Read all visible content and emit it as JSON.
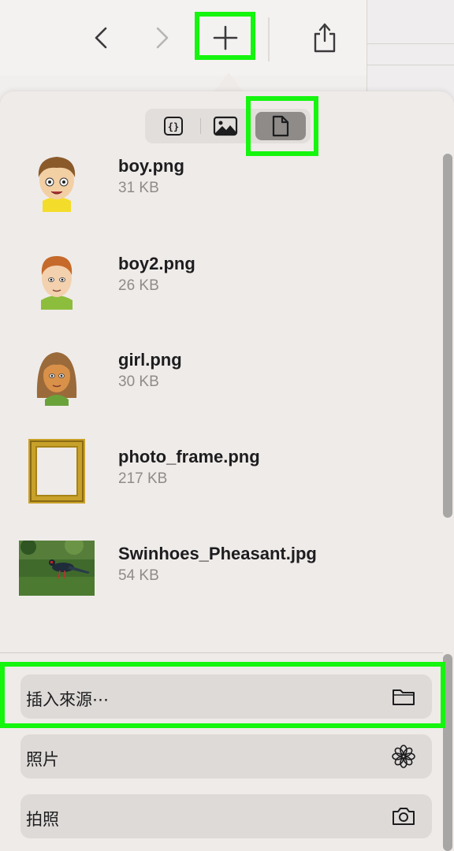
{
  "toolbar": {
    "buttons": [
      {
        "name": "back",
        "icon": "chevron-left-icon"
      },
      {
        "name": "forward",
        "icon": "chevron-right-icon"
      },
      {
        "name": "add",
        "icon": "plus-icon"
      },
      {
        "name": "share",
        "icon": "share-icon"
      }
    ]
  },
  "segmented": {
    "items": [
      {
        "icon": "code-braces-icon",
        "selected": false
      },
      {
        "icon": "photo-icon",
        "selected": false
      },
      {
        "icon": "document-icon",
        "selected": true
      }
    ]
  },
  "files": [
    {
      "name": "boy.png",
      "size": "31 KB"
    },
    {
      "name": "boy2.png",
      "size": "26 KB"
    },
    {
      "name": "girl.png",
      "size": "30 KB"
    },
    {
      "name": "photo_frame.png",
      "size": "217 KB"
    },
    {
      "name": "Swinhoes_Pheasant.jpg",
      "size": "54 KB"
    }
  ],
  "actions": [
    {
      "label": "插入來源⋯",
      "icon": "folder-icon"
    },
    {
      "label": "照片",
      "icon": "flower-icon"
    },
    {
      "label": "拍照",
      "icon": "camera-icon"
    }
  ],
  "colors": {
    "highlight": "#15f50e",
    "popover_bg": "#efebe9",
    "segment_active": "#8e8b89"
  }
}
